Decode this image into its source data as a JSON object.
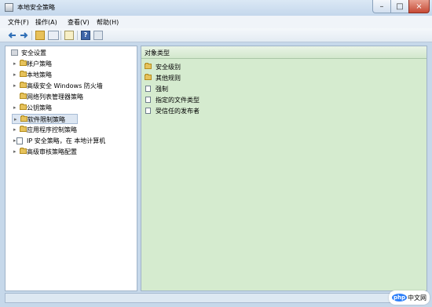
{
  "window": {
    "title": "本地安全策略"
  },
  "menu": {
    "items": [
      "文件(F)",
      "操作(A)",
      "查看(V)",
      "帮助(H)"
    ]
  },
  "toolbar": {
    "icons": [
      "back-icon",
      "forward-icon",
      "up-folder-icon",
      "view-icon",
      "export-icon",
      "help-icon",
      "console-icon"
    ]
  },
  "tree": {
    "root": "安全设置",
    "items": [
      {
        "label": "帐户策略",
        "icon": "folder-icon",
        "expander": "▸"
      },
      {
        "label": "本地策略",
        "icon": "folder-icon",
        "expander": "▸"
      },
      {
        "label": "高级安全 Windows 防火墙",
        "icon": "folder-icon",
        "expander": "▸"
      },
      {
        "label": "网络列表管理器策略",
        "icon": "folder-icon",
        "expander": ""
      },
      {
        "label": "公钥策略",
        "icon": "folder-icon",
        "expander": "▸"
      },
      {
        "label": "软件限制策略",
        "icon": "folder-icon",
        "expander": "▸",
        "selected": true
      },
      {
        "label": "应用程序控制策略",
        "icon": "folder-icon",
        "expander": "▸"
      },
      {
        "label": "IP 安全策略，在 本地计算机",
        "icon": "security-policy-icon",
        "expander": "▸"
      },
      {
        "label": "高级审核策略配置",
        "icon": "folder-icon",
        "expander": "▸"
      }
    ]
  },
  "details": {
    "column_header": "对象类型",
    "items": [
      {
        "label": "安全级别",
        "icon": "folder-icon"
      },
      {
        "label": "其他规则",
        "icon": "folder-icon"
      },
      {
        "label": "强制",
        "icon": "document-icon"
      },
      {
        "label": "指定的文件类型",
        "icon": "document-icon"
      },
      {
        "label": "受信任的发布者",
        "icon": "document-icon"
      }
    ]
  },
  "watermark": {
    "brand": "php",
    "text": "中文网"
  },
  "colors": {
    "details_background": "#d5ebcf",
    "selection": "#dce6f2"
  }
}
